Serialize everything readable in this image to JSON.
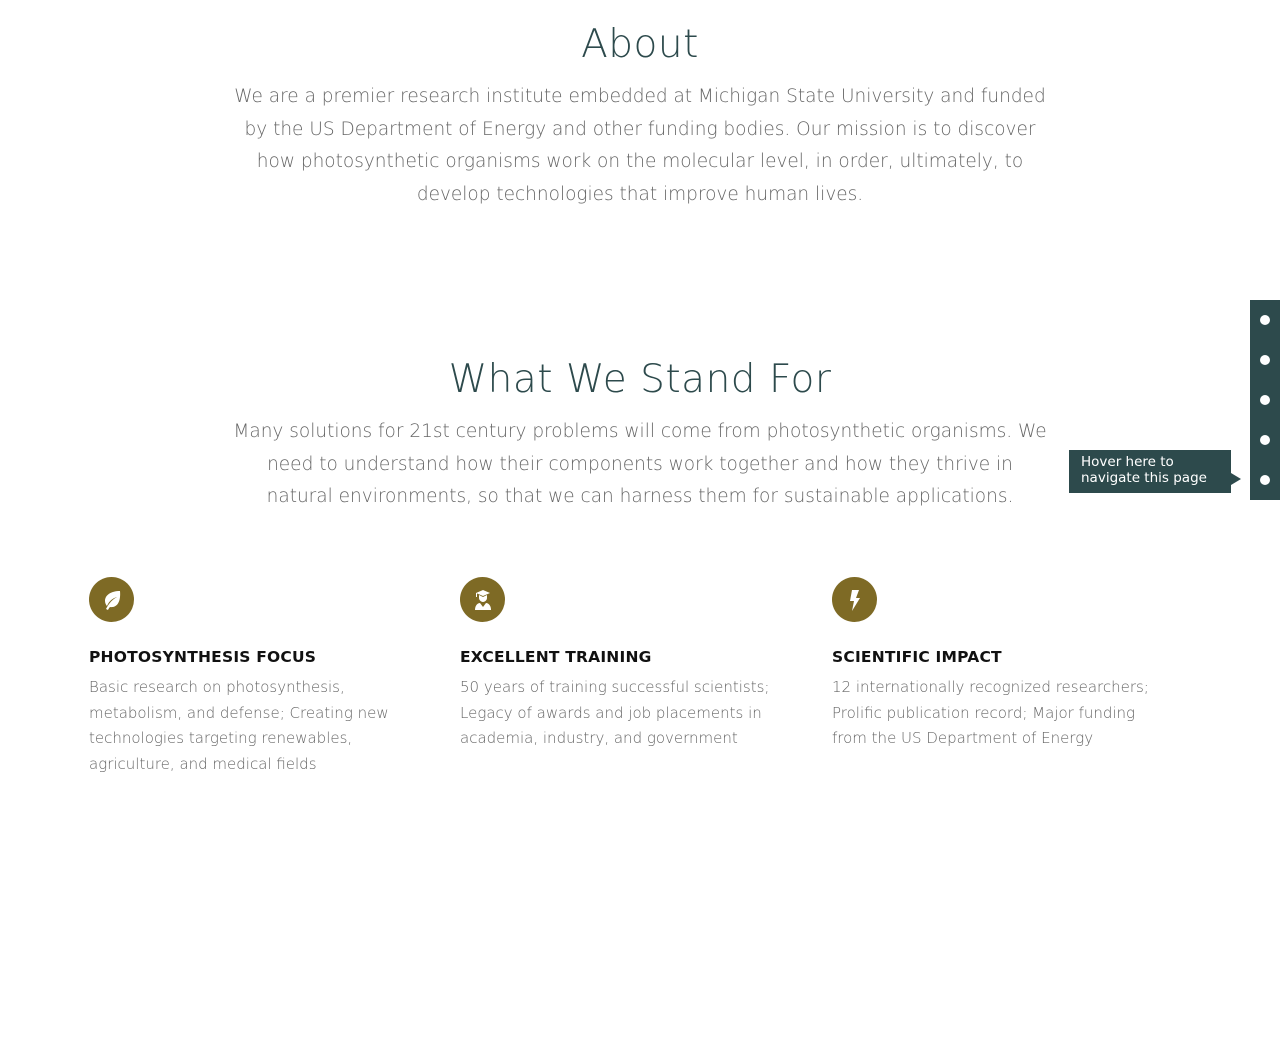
{
  "about": {
    "title": "About",
    "body": "We are a premier research institute embedded at Michigan State University and funded by the US Department of Energy and other funding bodies. Our mission is to discover how photosynthetic organisms work on the molecular level, in order, ultimately, to develop technologies that improve human lives."
  },
  "stand_for": {
    "title": "What We Stand For",
    "body": "Many solutions for 21st century problems will come from photosynthetic organisms. We need to understand how their components work together and how they thrive in natural environments, so that we can harness them for sustainable applications."
  },
  "features": [
    {
      "icon": "leaf-icon",
      "heading": "PHOTOSYNTHESIS FOCUS",
      "text": "Basic research on photosynthesis, metabolism, and defense; Creating new technologies targeting renewables, agriculture, and medical fields"
    },
    {
      "icon": "graduate-icon",
      "heading": "EXCELLENT TRAINING",
      "text": "50 years of training successful scientists; Legacy of awards and job placements in academia, industry, and government"
    },
    {
      "icon": "lightning-bolt-icon",
      "heading": "SCIENTIFIC IMPACT",
      "text": "12 internationally recognized researchers; Prolific publication record; Major funding from the US Department of Energy"
    }
  ],
  "side_nav": {
    "tooltip_line1": "Hover here to",
    "tooltip_line2": "navigate this page",
    "dot_count": 5
  },
  "colors": {
    "heading": "#2d4a4c",
    "accent": "#7e6a25",
    "nav_background": "#2d4a4c",
    "body_text": "#666666"
  }
}
